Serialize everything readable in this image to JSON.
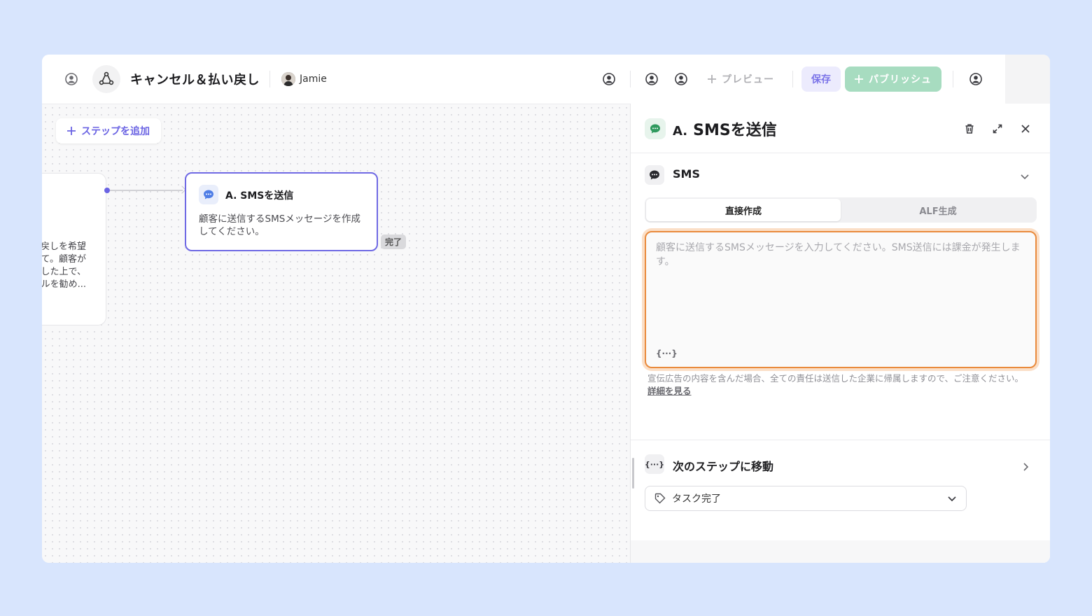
{
  "header": {
    "title": "キャンセル＆払い戻し",
    "owner_name": "Jamie",
    "preview_label": "プレビュー",
    "save_label": "保存",
    "publish_label": "パブリッシュ"
  },
  "canvas": {
    "add_step_label": "ステップを追加",
    "prev_node_text": "戻しを希望\nて。顧客が\nした上で、\nルを勧め...",
    "sms_node": {
      "title": "A. SMSを送信",
      "description": "顧客に送信するSMSメッセージを作成してください。"
    },
    "done_badge": "完了"
  },
  "panel": {
    "title_prefix": "A.",
    "title": "SMSを送信",
    "sms_section_label": "SMS",
    "tabs": [
      {
        "label": "直接作成",
        "active": true
      },
      {
        "label": "ALF生成",
        "active": false
      }
    ],
    "textarea_placeholder": "顧客に送信するSMSメッセージを入力してください。SMS送信には課金が発生します。",
    "variable_button": "{···}",
    "notice_text": "宣伝広告の内容を含んだ場合、全ての責任は送信した企業に帰属しますので、ご注意ください。",
    "notice_link": "詳細を見る",
    "next_step_icon": "{···}",
    "next_step_label": "次のステップに移動",
    "task_select_value": "タスク完了"
  },
  "colors": {
    "accent": "#6a63e3",
    "publish": "#a7dcc0",
    "focus_border": "#e98a3c",
    "sms_green": "#2f9a5e"
  }
}
